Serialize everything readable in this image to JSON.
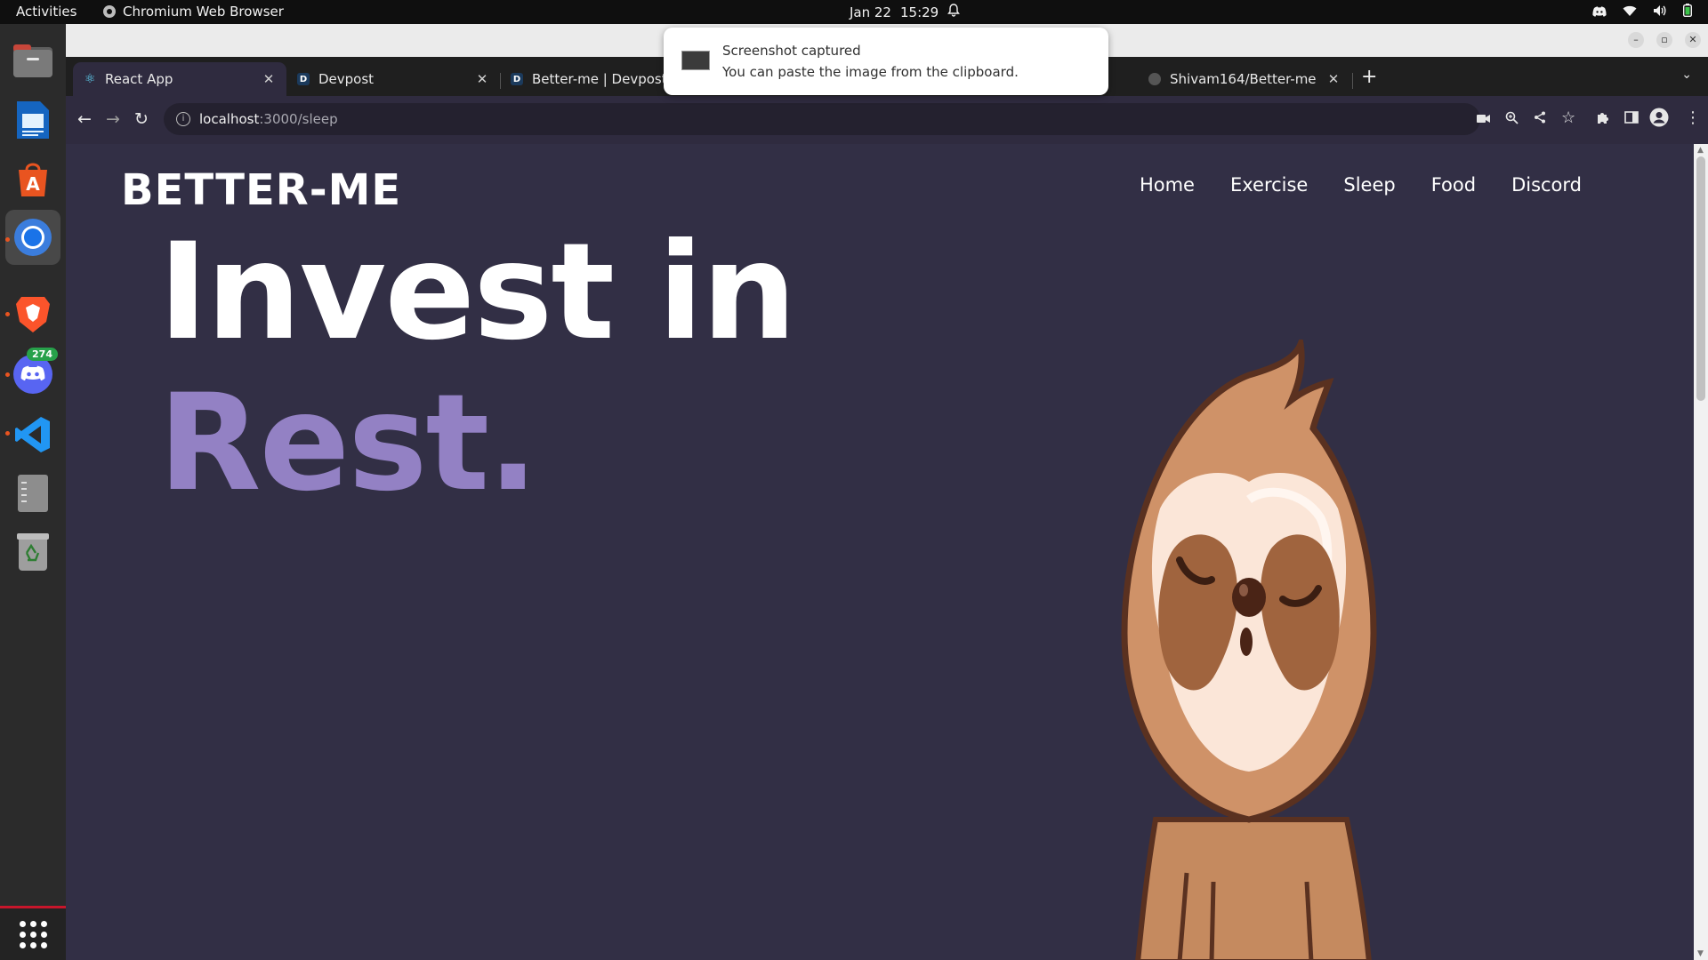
{
  "topbar": {
    "activities": "Activities",
    "app_name": "Chromium Web Browser",
    "date": "Jan 22",
    "time": "15:29"
  },
  "dock": {
    "items": [
      {
        "name": "files",
        "icon": "folder-icon"
      },
      {
        "name": "writer",
        "icon": "document-icon"
      },
      {
        "name": "software",
        "icon": "app-store-icon"
      },
      {
        "name": "chromium",
        "icon": "chromium-icon"
      },
      {
        "name": "brave",
        "icon": "brave-icon"
      },
      {
        "name": "discord",
        "icon": "discord-icon",
        "badge": "274"
      },
      {
        "name": "vscode",
        "icon": "vscode-icon"
      },
      {
        "name": "text-editor",
        "icon": "text-editor-icon"
      },
      {
        "name": "trash",
        "icon": "trash-icon"
      }
    ]
  },
  "tabs": [
    {
      "label": "React App",
      "favicon": "react-icon"
    },
    {
      "label": "Devpost",
      "favicon": "D"
    },
    {
      "label": "Better-me | Devpost",
      "favicon": "D"
    },
    {
      "label": "Shivam164/Better-me",
      "favicon": "github-icon"
    }
  ],
  "address": {
    "host": "localhost",
    "path": ":3000/sleep"
  },
  "site": {
    "logo": "BETTER-ME",
    "nav": [
      "Home",
      "Exercise",
      "Sleep",
      "Food",
      "Discord"
    ],
    "hero_line1": "Invest in",
    "hero_line2": "Rest."
  },
  "notification": {
    "title": "Screenshot captured",
    "body": "You can paste the image from the clipboard."
  },
  "colors": {
    "page_bg": "#322f45",
    "hero_accent": "#9381c4",
    "topbar_bg": "#0f0f0f",
    "dock_bg": "#2b2b2b"
  }
}
